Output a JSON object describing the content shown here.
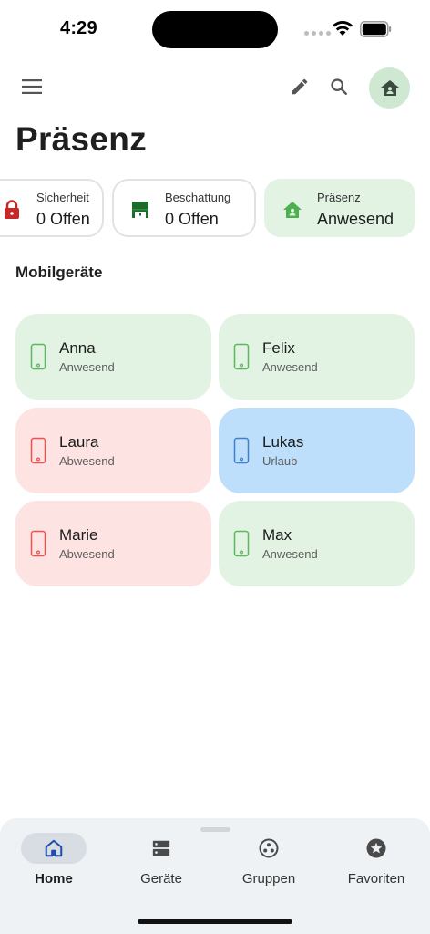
{
  "status_bar": {
    "time": "4:29"
  },
  "app_bar": {
    "menu_icon": "menu-icon",
    "edit_icon": "pencil-icon",
    "search_icon": "search-icon",
    "profile_icon": "home-shield-icon"
  },
  "page": {
    "title": "Präsenz"
  },
  "chips": [
    {
      "label": "Sicherheit",
      "value": "0 Offen",
      "icon": "lock-icon",
      "color": "#c62828"
    },
    {
      "label": "Beschattung",
      "value": "0 Offen",
      "icon": "shutter-icon",
      "color": "#1b6b2a"
    },
    {
      "label": "Präsenz",
      "value": "Anwesend",
      "icon": "home-icon",
      "color": "#4caf50",
      "active": true
    }
  ],
  "section": {
    "title": "Mobilgeräte"
  },
  "devices": [
    {
      "name": "Anna",
      "status": "Anwesend",
      "color": "#e2f2e3",
      "icon_color": "#5cb85c"
    },
    {
      "name": "Felix",
      "status": "Anwesend",
      "color": "#e2f2e3",
      "icon_color": "#5cb85c"
    },
    {
      "name": "Laura",
      "status": "Abwesend",
      "color": "#fde3e2",
      "icon_color": "#ef5350"
    },
    {
      "name": "Lukas",
      "status": "Urlaub",
      "color": "#bddffb",
      "icon_color": "#3f7fd0"
    },
    {
      "name": "Marie",
      "status": "Abwesend",
      "color": "#fde3e2",
      "icon_color": "#ef5350"
    },
    {
      "name": "Max",
      "status": "Anwesend",
      "color": "#e2f2e3",
      "icon_color": "#5cb85c"
    }
  ],
  "bottom_nav": [
    {
      "label": "Home",
      "icon": "home-icon",
      "active": true
    },
    {
      "label": "Geräte",
      "icon": "devices-icon"
    },
    {
      "label": "Gruppen",
      "icon": "groups-icon"
    },
    {
      "label": "Favoriten",
      "icon": "star-icon"
    }
  ]
}
